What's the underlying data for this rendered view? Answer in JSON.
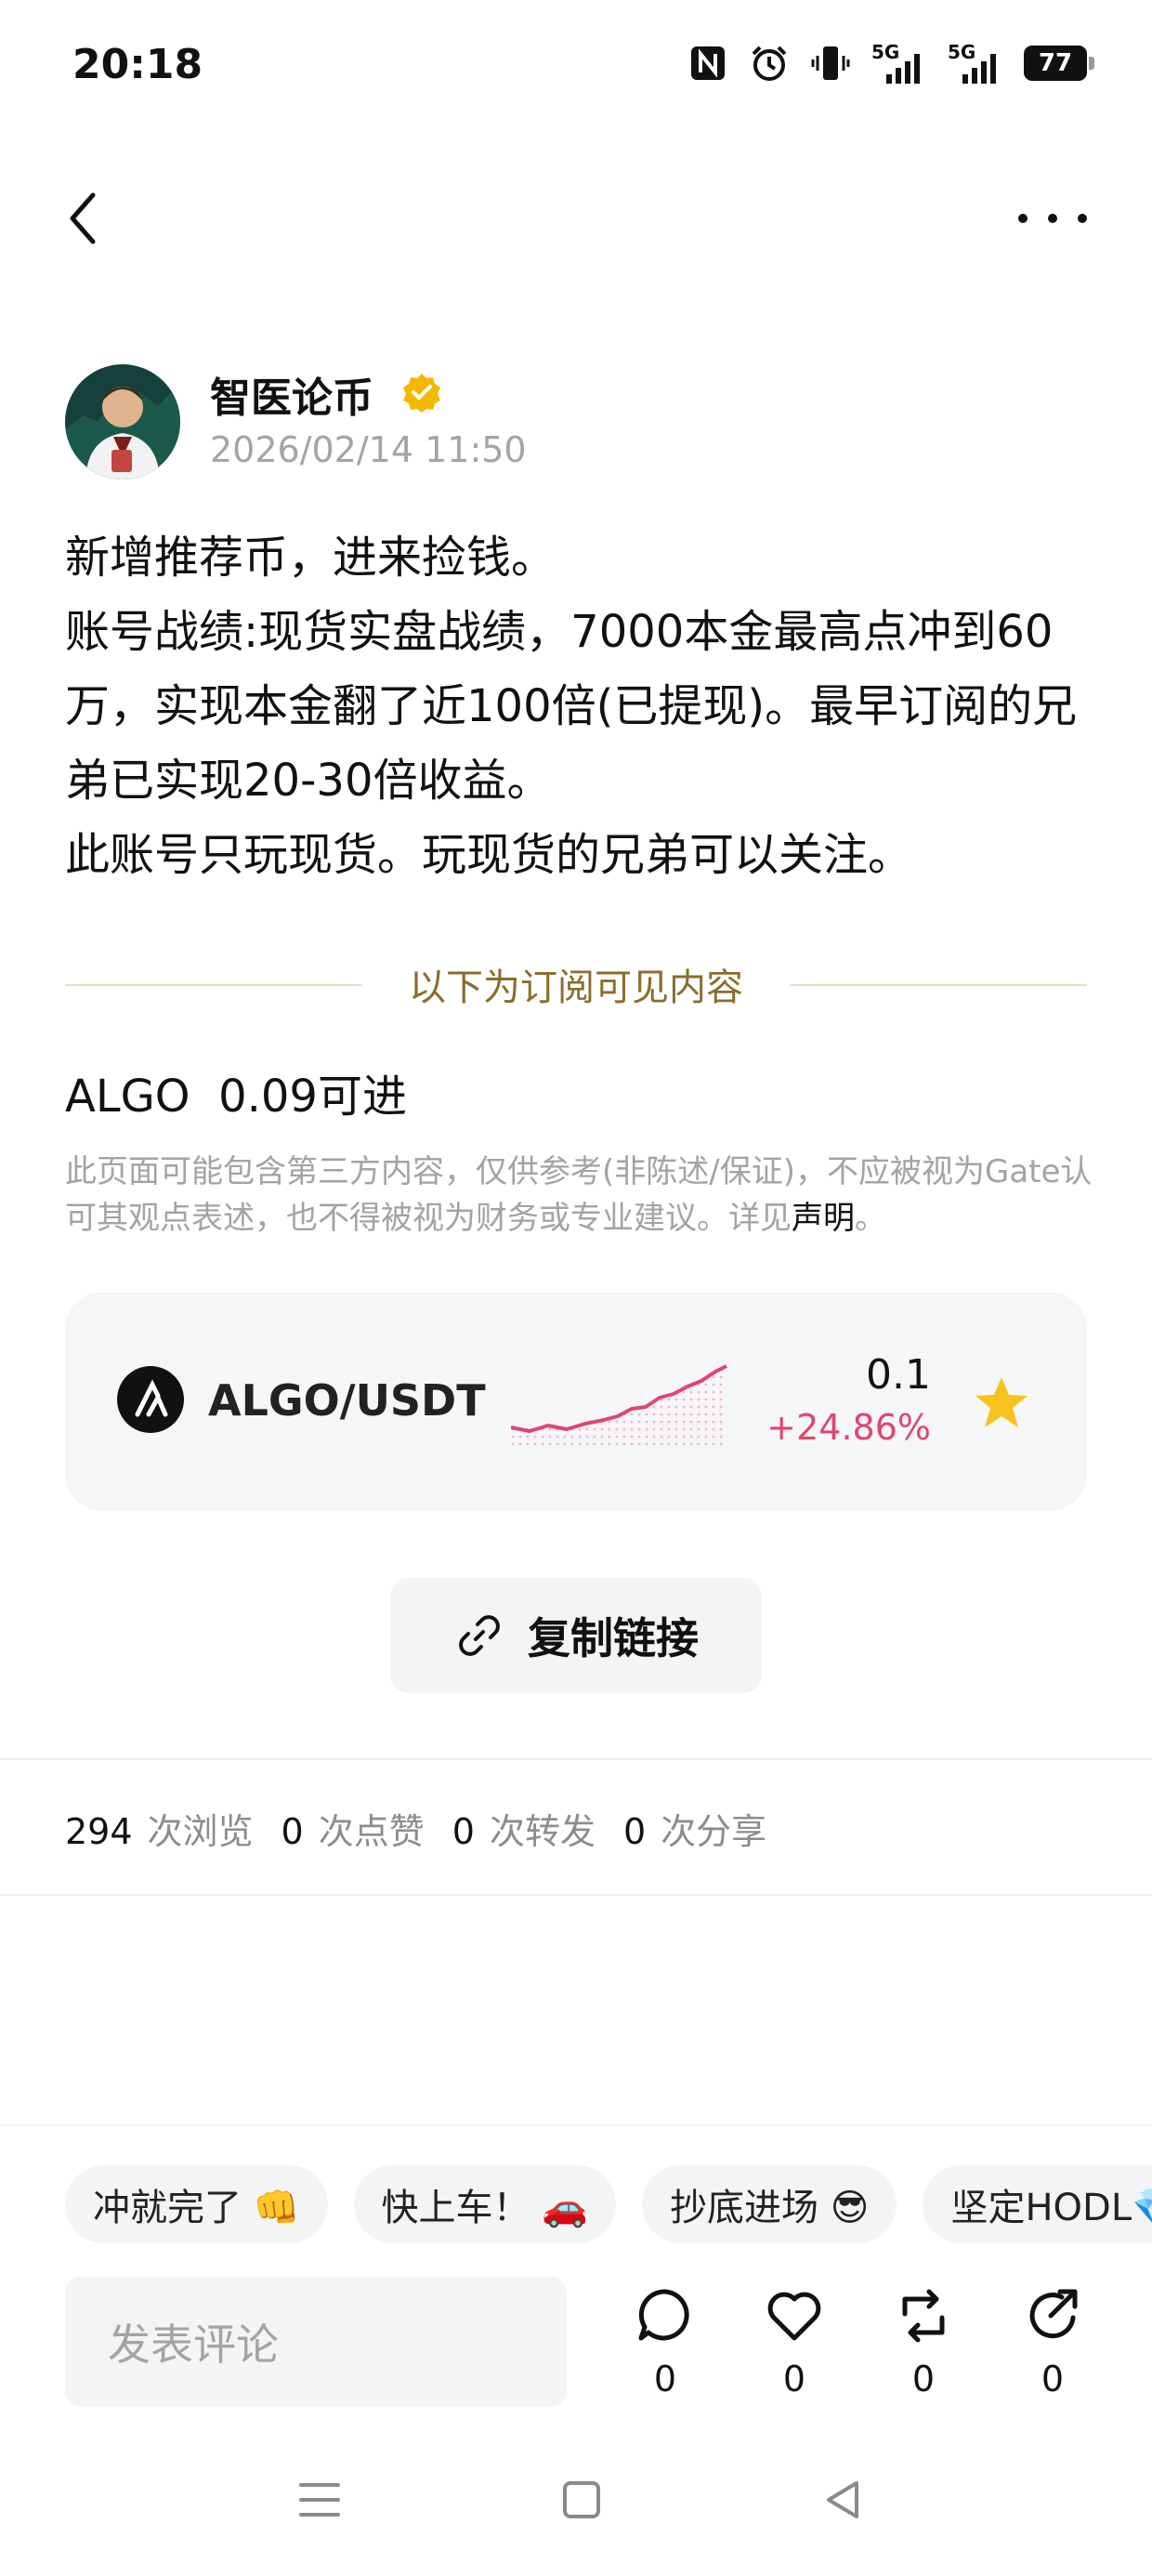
{
  "status_bar": {
    "time": "20:18",
    "icons": [
      "nfc-icon",
      "alarm-icon",
      "vibrate-icon",
      "signal-5g-icon",
      "signal-5g-icon"
    ],
    "network_labels": [
      "5G",
      "5G"
    ],
    "battery": "77"
  },
  "header": {
    "back_icon": "chevron-left-icon",
    "more_icon": "more-horizontal-icon"
  },
  "post": {
    "author": "智医论币",
    "verified_icon": "verified-badge-icon",
    "timestamp": "2026/02/14 11:50",
    "paragraphs": [
      "新增推荐币，进来捡钱。",
      "账号战绩:现货实盘战绩，7000本金最高点冲到60万，实现本金翻了近100倍(已提现)。最早订阅的兄弟已实现20-30倍收益。",
      "此账号只玩现货。玩现货的兄弟可以关注。"
    ],
    "subscribe_divider": "以下为订阅可见内容",
    "algo_line": "ALGO  0.09可进",
    "disclaimer": "此页面可能包含第三方内容，仅供参考(非陈述/保证)，不应被视为Gate认可其观点表述，也不得被视为财务或专业建议。详见",
    "disclaimer_link": "声明",
    "disclaimer_end": "。"
  },
  "ticker": {
    "pair": "ALGO/USDT",
    "price": "0.1",
    "change": "+24.86%",
    "change_color": "#e0466e",
    "star_color": "#f7c21d"
  },
  "copy_link": {
    "label": "复制链接"
  },
  "stats": [
    {
      "num": "294",
      "label": "次浏览"
    },
    {
      "num": "0",
      "label": "次点赞"
    },
    {
      "num": "0",
      "label": "次转发"
    },
    {
      "num": "0",
      "label": "次分享"
    }
  ],
  "quick_replies": [
    "冲就完了 👊",
    "快上车！ 🚗",
    "抄底进场 😎",
    "坚定HODL💎"
  ],
  "bottom": {
    "comment_placeholder": "发表评论",
    "actions": [
      {
        "icon": "comment-icon",
        "count": "0"
      },
      {
        "icon": "heart-icon",
        "count": "0"
      },
      {
        "icon": "repost-icon",
        "count": "0"
      },
      {
        "icon": "share-icon",
        "count": "0"
      }
    ]
  },
  "system_nav": [
    "menu-icon",
    "home-icon",
    "back-triangle-icon"
  ]
}
